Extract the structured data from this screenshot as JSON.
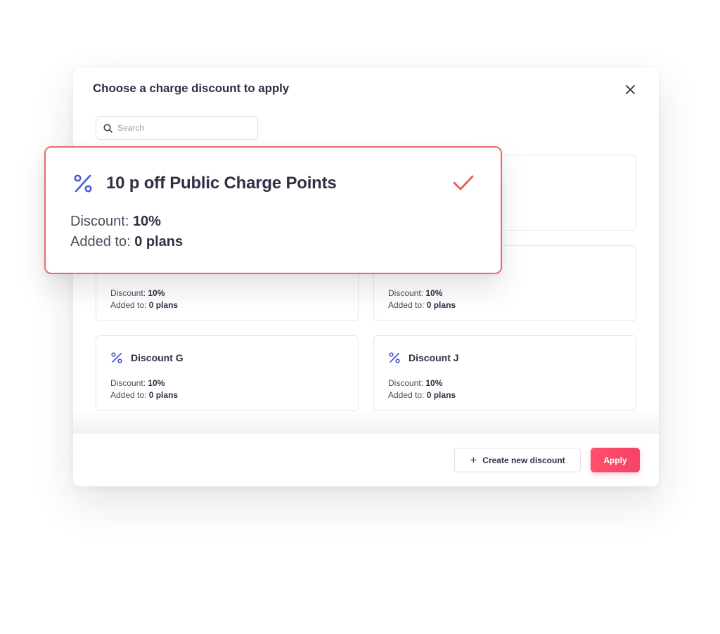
{
  "modal": {
    "title": "Choose a charge discount to apply",
    "search_placeholder": "Search",
    "icons": {
      "close": "close-icon",
      "search": "search-icon",
      "percent": "percent-icon",
      "check": "check-icon",
      "plus": "plus-icon"
    }
  },
  "featured": {
    "name": "10 p off Public Charge Points",
    "discount_label": "Discount: ",
    "discount_value": "10%",
    "added_label": "Added to: ",
    "added_value": "0 plans",
    "selected": true
  },
  "cards": [
    {
      "name": "",
      "discount_label": "Discount: ",
      "discount_value": "10%",
      "added_label": "Added to: ",
      "added_value": "0 plans"
    },
    {
      "name": "",
      "discount_label": "Discount: ",
      "discount_value": "10%",
      "added_label": "Added to: ",
      "added_value": "0 plans"
    },
    {
      "name": "Discount G",
      "discount_label": "Discount: ",
      "discount_value": "10%",
      "added_label": "Added to: ",
      "added_value": "0 plans"
    },
    {
      "name": "Discount J",
      "discount_label": "Discount: ",
      "discount_value": "10%",
      "added_label": "Added to: ",
      "added_value": "0 plans"
    }
  ],
  "footer": {
    "create_label": "Create new discount",
    "apply_label": "Apply"
  },
  "colors": {
    "accent": "#f4436a",
    "selected_border": "#e96c6c",
    "icon_blue": "#4a5ad8",
    "check": "#ea5a5a"
  }
}
